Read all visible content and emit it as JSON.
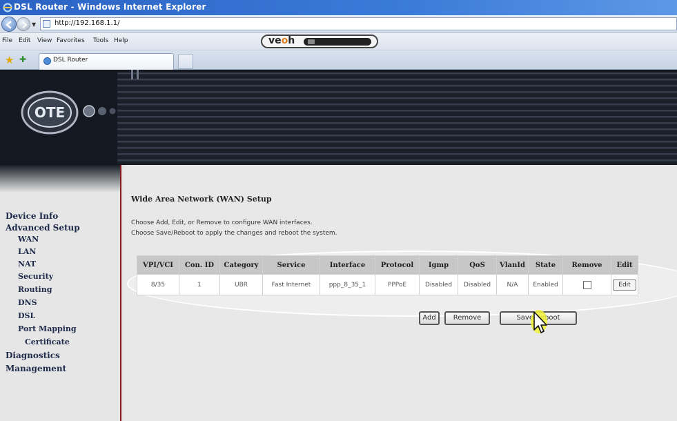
{
  "window": {
    "title": "DSL Router - Windows Internet Explorer",
    "url": "http://192.168.1.1/"
  },
  "menu": {
    "items": [
      "File",
      "Edit",
      "View",
      "Favorites",
      "Tools",
      "Help"
    ]
  },
  "toolbar": {
    "veoh_logo": "veoh"
  },
  "tabs": {
    "active_label": "DSL Router"
  },
  "brand": {
    "logo_text": "OTE"
  },
  "sidebar": {
    "items": [
      {
        "label": "Device Info",
        "level": 1
      },
      {
        "label": "Advanced Setup",
        "level": 1
      },
      {
        "label": "WAN",
        "level": 2
      },
      {
        "label": "LAN",
        "level": 2
      },
      {
        "label": "NAT",
        "level": 2
      },
      {
        "label": "Security",
        "level": 2
      },
      {
        "label": "Routing",
        "level": 2
      },
      {
        "label": "DNS",
        "level": 2
      },
      {
        "label": "DSL",
        "level": 2
      },
      {
        "label": "Port Mapping",
        "level": 2
      },
      {
        "label": "Certificate",
        "level": 2
      },
      {
        "label": "Diagnostics",
        "level": 1
      },
      {
        "label": "Management",
        "level": 1
      }
    ]
  },
  "main": {
    "title": "Wide Area Network (WAN) Setup",
    "desc_line1": "Choose Add, Edit, or Remove to configure WAN interfaces.",
    "desc_line2": "Choose Save/Reboot to apply the changes and reboot the system.",
    "table": {
      "headers": [
        "VPI/VCI",
        "Con. ID",
        "Category",
        "Service",
        "Interface",
        "Protocol",
        "Igmp",
        "QoS",
        "VlanId",
        "State",
        "Remove",
        "Edit"
      ],
      "rows": [
        [
          "8/35",
          "1",
          "UBR",
          "Fast Internet",
          "ppp_8_35_1",
          "PPPoE",
          "Disabled",
          "Disabled",
          "N/A",
          "Enabled",
          "",
          "Edit"
        ]
      ]
    },
    "buttons": {
      "add": "Add",
      "remove": "Remove",
      "save_reboot": "Save/Reboot"
    }
  },
  "colors": {
    "titlebar": "#2b63c4",
    "sidebar_text": "#1e2a4a",
    "table_header": "#c7c7c7",
    "cursor_highlight": "#f2f23a"
  }
}
